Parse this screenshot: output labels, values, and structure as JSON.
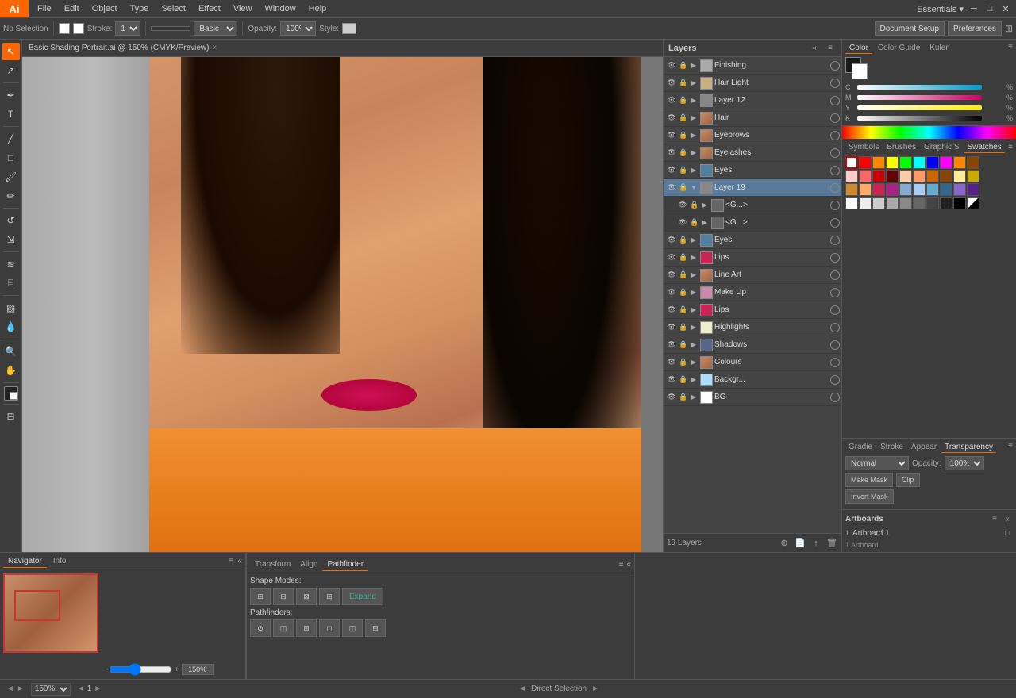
{
  "app": {
    "logo": "Ai",
    "title": "Basic Shading Portrait.ai @ 150% (CMYK/Preview)",
    "tab_close": "×"
  },
  "menu": {
    "items": [
      "File",
      "Edit",
      "Object",
      "Type",
      "Select",
      "Effect",
      "View",
      "Window",
      "Help"
    ]
  },
  "toolbar": {
    "no_selection": "No Selection",
    "stroke_label": "Stroke:",
    "basic_label": "Basic",
    "opacity_label": "Opacity:",
    "opacity_val": "100%",
    "style_label": "Style:",
    "doc_setup": "Document Setup",
    "preferences": "Preferences"
  },
  "canvas": {
    "tab_label": "Basic Shading Portrait.ai @ 150% (CMYK/Preview)"
  },
  "layers": {
    "title": "Layers",
    "count_label": "19 Layers",
    "items": [
      {
        "name": "Finishing",
        "visible": true,
        "locked": true,
        "expanded": false,
        "selected": false,
        "sub": false
      },
      {
        "name": "Hair Light",
        "visible": true,
        "locked": true,
        "expanded": false,
        "selected": false,
        "sub": false
      },
      {
        "name": "Layer 12",
        "visible": true,
        "locked": true,
        "expanded": false,
        "selected": false,
        "sub": false
      },
      {
        "name": "Hair",
        "visible": true,
        "locked": true,
        "expanded": false,
        "selected": false,
        "sub": false
      },
      {
        "name": "Eyebrows",
        "visible": true,
        "locked": true,
        "expanded": false,
        "selected": false,
        "sub": false
      },
      {
        "name": "Eyelashes",
        "visible": true,
        "locked": true,
        "expanded": false,
        "selected": false,
        "sub": false
      },
      {
        "name": "Eyes",
        "visible": true,
        "locked": true,
        "expanded": false,
        "selected": false,
        "sub": false
      },
      {
        "name": "Layer 19",
        "visible": true,
        "locked": false,
        "expanded": true,
        "selected": true,
        "sub": false
      },
      {
        "name": "<G...>",
        "visible": true,
        "locked": true,
        "expanded": false,
        "selected": false,
        "sub": true
      },
      {
        "name": "<G...>",
        "visible": true,
        "locked": true,
        "expanded": false,
        "selected": false,
        "sub": true
      },
      {
        "name": "Eyes",
        "visible": true,
        "locked": true,
        "expanded": false,
        "selected": false,
        "sub": false
      },
      {
        "name": "Lips",
        "visible": true,
        "locked": true,
        "expanded": false,
        "selected": false,
        "sub": false
      },
      {
        "name": "Line Art",
        "visible": true,
        "locked": true,
        "expanded": false,
        "selected": false,
        "sub": false
      },
      {
        "name": "Make Up",
        "visible": true,
        "locked": true,
        "expanded": false,
        "selected": false,
        "sub": false
      },
      {
        "name": "Lips",
        "visible": true,
        "locked": true,
        "expanded": false,
        "selected": false,
        "sub": false
      },
      {
        "name": "Highlights",
        "visible": true,
        "locked": true,
        "expanded": false,
        "selected": false,
        "sub": false
      },
      {
        "name": "Shadows",
        "visible": true,
        "locked": true,
        "expanded": false,
        "selected": false,
        "sub": false
      },
      {
        "name": "Colours",
        "visible": true,
        "locked": true,
        "expanded": false,
        "selected": false,
        "sub": false
      },
      {
        "name": "Backgr...",
        "visible": true,
        "locked": true,
        "expanded": false,
        "selected": false,
        "sub": false
      },
      {
        "name": "BG",
        "visible": true,
        "locked": true,
        "expanded": false,
        "selected": false,
        "sub": false
      }
    ]
  },
  "color_panel": {
    "tabs": [
      "Color",
      "Color Guide",
      "Kuler"
    ],
    "active_tab": "Color",
    "sliders": [
      {
        "label": "C",
        "value": "",
        "percent": "%"
      },
      {
        "label": "M",
        "value": "",
        "percent": "%"
      },
      {
        "label": "Y",
        "value": "",
        "percent": "%"
      },
      {
        "label": "K",
        "value": "",
        "percent": "%"
      }
    ]
  },
  "swatches": {
    "tabs": [
      "Symbols",
      "Brushes",
      "Graphic S",
      "Swatches"
    ],
    "active_tab": "Swatches"
  },
  "transparency": {
    "tabs": [
      "Gradie",
      "Stroke",
      "Appear",
      "Transparency"
    ],
    "active_tab": "Transparency",
    "blend_mode": "Normal",
    "opacity_label": "Opacity:",
    "opacity_val": "100%",
    "make_mask_btn": "Make Mask",
    "clip_btn": "Clip",
    "invert_mask_btn": "Invert Mask"
  },
  "artboards": {
    "title": "Artboards",
    "items": [
      {
        "num": "1",
        "name": "Artboard 1"
      }
    ],
    "footer": "1 Artboard"
  },
  "navigator": {
    "tabs": [
      "Navigator",
      "Info"
    ],
    "active_tab": "Navigator",
    "zoom_val": "150%"
  },
  "pathfinder": {
    "tabs": [
      "Transform",
      "Align",
      "Pathfinder"
    ],
    "active_tab": "Pathfinder",
    "shape_modes_label": "Shape Modes:",
    "pathfinders_label": "Pathfinders:",
    "expand_btn": "Expand"
  },
  "status": {
    "zoom_val": "150%",
    "artboard_num": "1",
    "tool_name": "Direct Selection"
  }
}
